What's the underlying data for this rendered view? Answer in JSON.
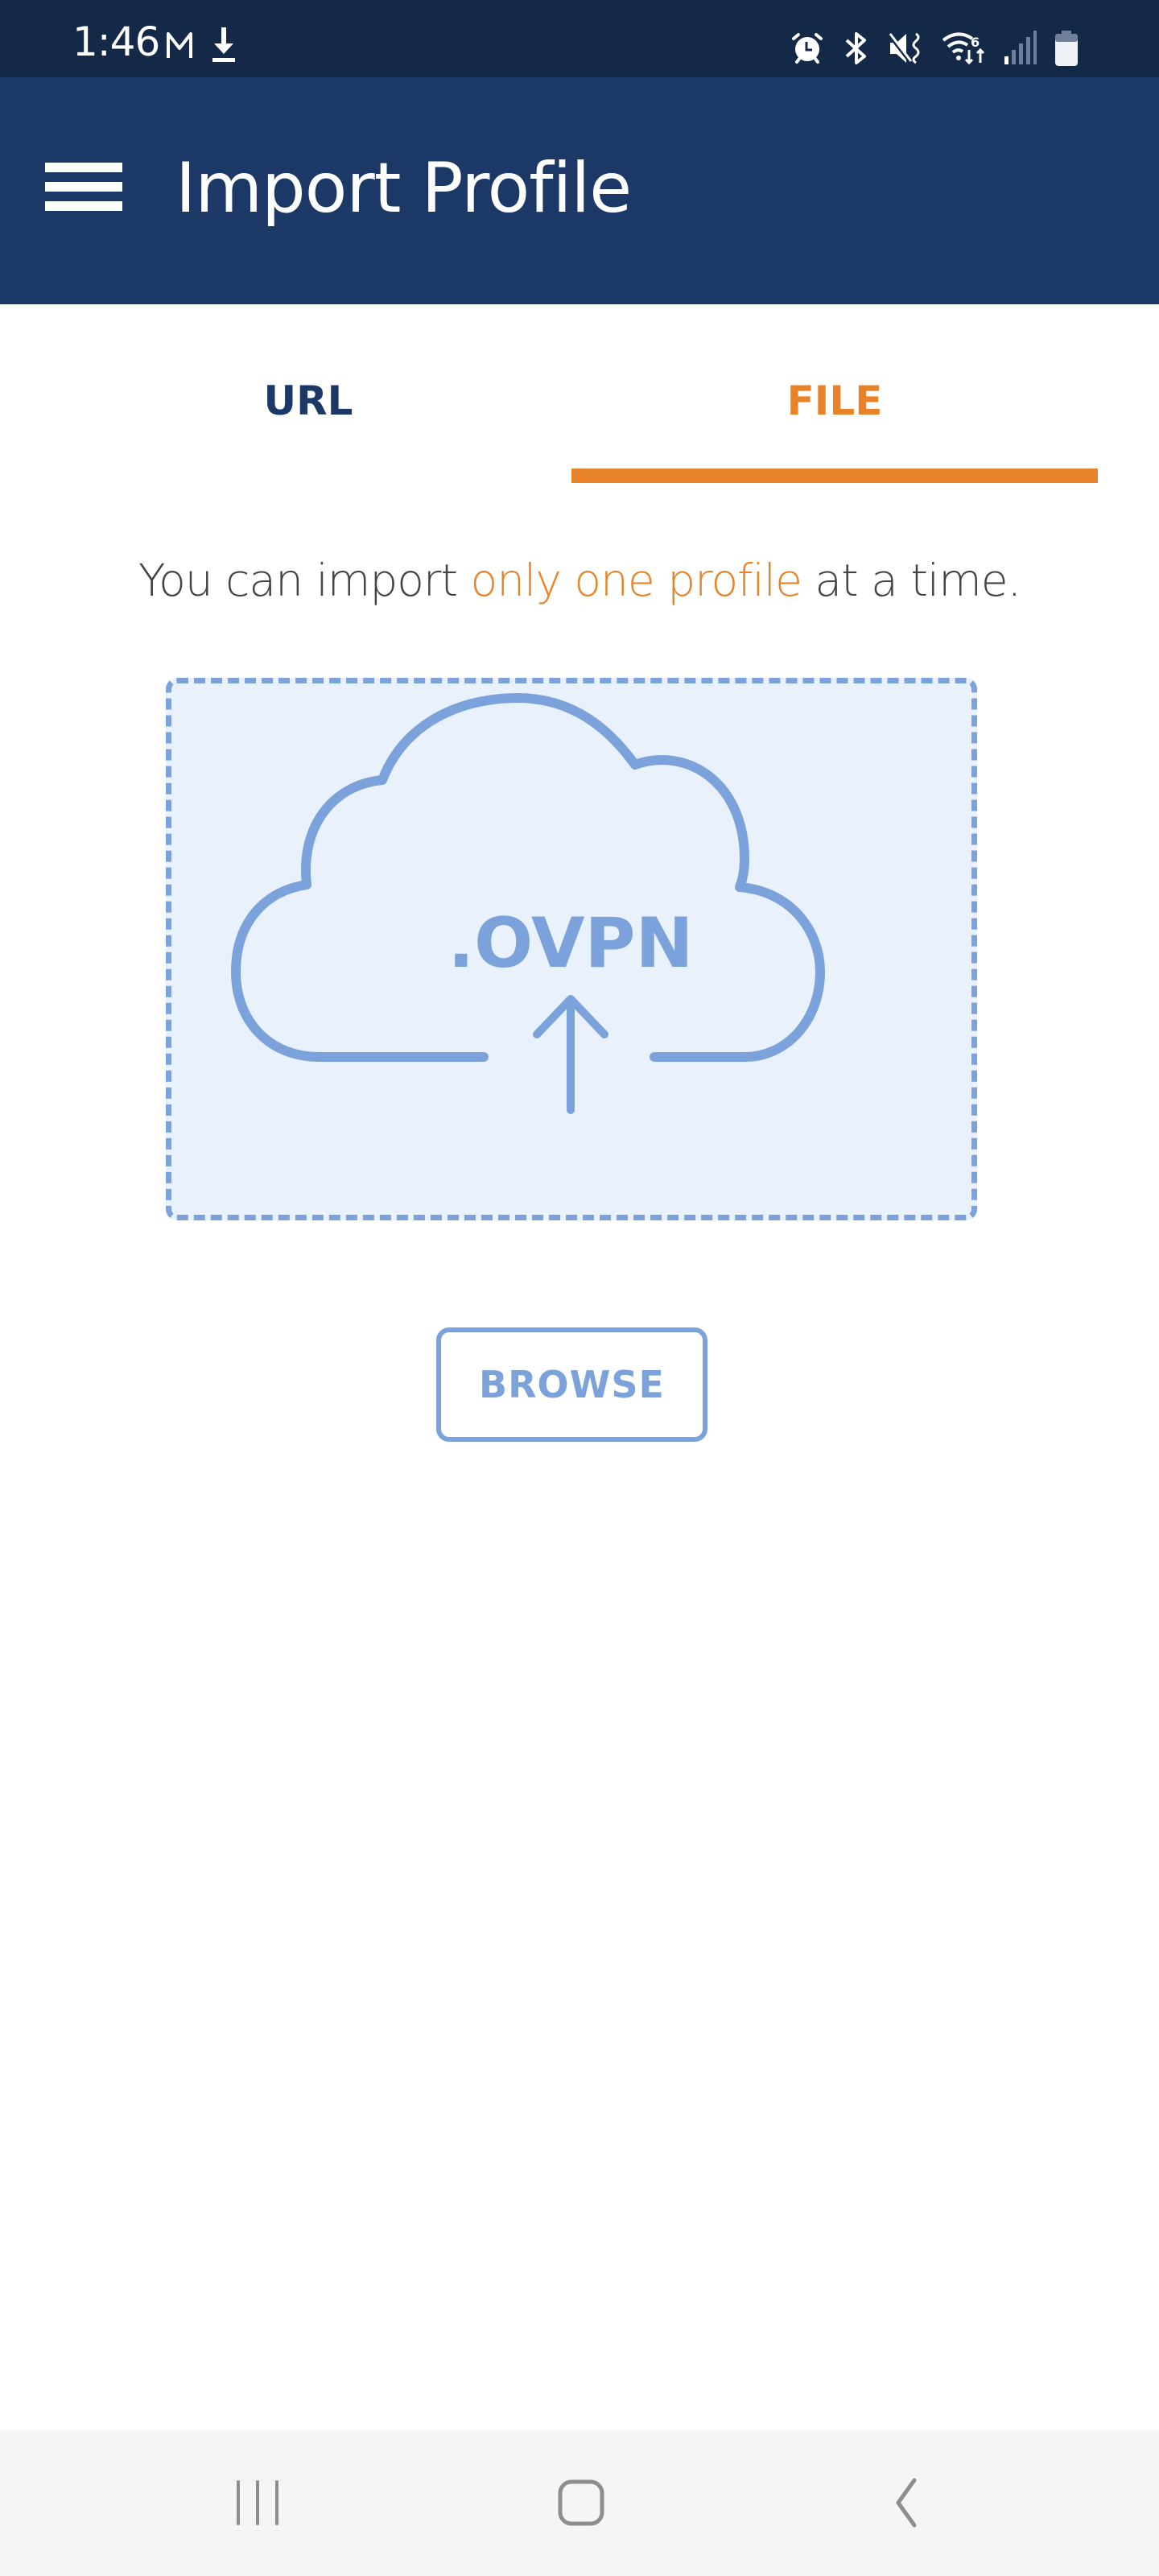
{
  "status_bar": {
    "time": "1:46",
    "left_icons": [
      "gmail-icon",
      "download-icon"
    ],
    "right_icons": [
      "alarm-icon",
      "bluetooth-icon",
      "mute-vibrate-icon",
      "wifi-6-icon",
      "signal-icon",
      "battery-icon"
    ]
  },
  "app_bar": {
    "title": "Import Profile",
    "menu_icon": "hamburger-menu-icon"
  },
  "tabs": [
    {
      "label": "URL",
      "active": false
    },
    {
      "label": "FILE",
      "active": true
    }
  ],
  "notice": {
    "prefix": "You can import ",
    "highlight": "only one profile",
    "suffix": " at a time."
  },
  "drop_zone": {
    "icon": "cloud-upload-icon",
    "file_ext": ".OVPN"
  },
  "browse_button": {
    "label": "BROWSE"
  },
  "colors": {
    "app_bar": "#1b3867",
    "status_bar": "#142848",
    "accent": "#e8832a",
    "drop_zone_stroke": "#7ba2da",
    "drop_zone_fill": "#e9f1fc"
  },
  "nav_bar": {
    "buttons": [
      "recents-icon",
      "home-icon",
      "back-icon"
    ]
  }
}
